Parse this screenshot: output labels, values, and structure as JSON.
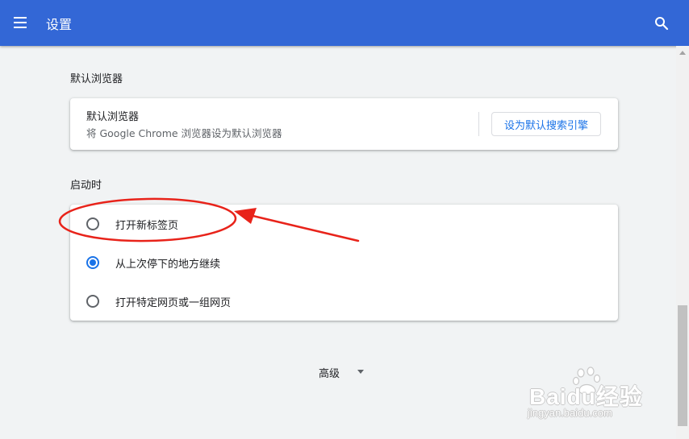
{
  "header": {
    "title": "设置",
    "menu_icon": "hamburger-menu-icon",
    "search_icon": "search-icon",
    "bar_color": "#3367d6"
  },
  "default_browser": {
    "section_title": "默认浏览器",
    "row_title": "默认浏览器",
    "row_description": "将 Google Chrome 浏览器设为默认浏览器",
    "button_label": "设为默认搜索引擎"
  },
  "on_startup": {
    "section_title": "启动时",
    "options": [
      {
        "label": "打开新标签页",
        "checked": false
      },
      {
        "label": "从上次停下的地方继续",
        "checked": true
      },
      {
        "label": "打开特定网页或一组网页",
        "checked": false
      }
    ]
  },
  "advanced": {
    "label": "高级",
    "icon": "arrow-drop-down-icon"
  },
  "annotation": {
    "color": "#e8231a",
    "shapes": [
      "red-ellipse-highlight",
      "red-arrow-pointer"
    ]
  },
  "watermark": {
    "logo": "Baidu经验",
    "url": "jingyan.baidu.com"
  },
  "colors": {
    "accent": "#1a73e8",
    "background": "#f1f3f4"
  }
}
